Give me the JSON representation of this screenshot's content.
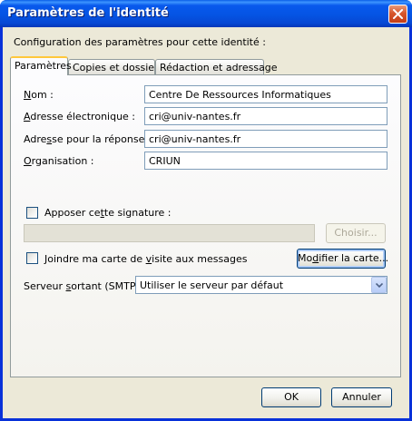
{
  "window": {
    "title": "Paramètres de l'identité"
  },
  "heading": "Configuration des paramètres pour cette identité :",
  "tabs": [
    {
      "label": "Paramètres",
      "active": true
    },
    {
      "label": "Copies et dossiers",
      "active": false
    },
    {
      "label": "Rédaction et adressage",
      "active": false
    }
  ],
  "fields": {
    "name": {
      "label_pre": "",
      "label_u": "N",
      "label_post": "om :",
      "value": "Centre De Ressources Informatiques"
    },
    "email": {
      "label_pre": "",
      "label_u": "A",
      "label_post": "dresse électronique :",
      "value": "cri@univ-nantes.fr"
    },
    "reply": {
      "label_pre": "Adre",
      "label_u": "s",
      "label_post": "se pour la réponse :",
      "value": "cri@univ-nantes.fr"
    },
    "org": {
      "label_pre": "",
      "label_u": "O",
      "label_post": "rganisation :",
      "value": "CRIUN"
    }
  },
  "signature": {
    "label_pre": "Apposer ce",
    "label_u": "t",
    "label_post": "te signature :",
    "checked": false,
    "choose_button": "Choisir..."
  },
  "vcard": {
    "label_pre": "Joindre ma carte de ",
    "label_u": "v",
    "label_post": "isite aux messages",
    "checked": false,
    "modify_pre": "Mo",
    "modify_u": "d",
    "modify_post": "ifier la carte..."
  },
  "smtp": {
    "label_pre": "Serveur ",
    "label_u": "s",
    "label_post": "ortant (SMTP):",
    "value": "Utiliser le serveur par défaut"
  },
  "buttons": {
    "ok": "OK",
    "cancel": "Annuler"
  },
  "icons": {
    "close": "close-icon",
    "dropdown": "chevron-down-icon"
  },
  "colors": {
    "titlebar": "#0554e3",
    "dialog_bg": "#ece9d8",
    "close_button": "#d7562b",
    "tab_highlight": "#ffc83c"
  }
}
